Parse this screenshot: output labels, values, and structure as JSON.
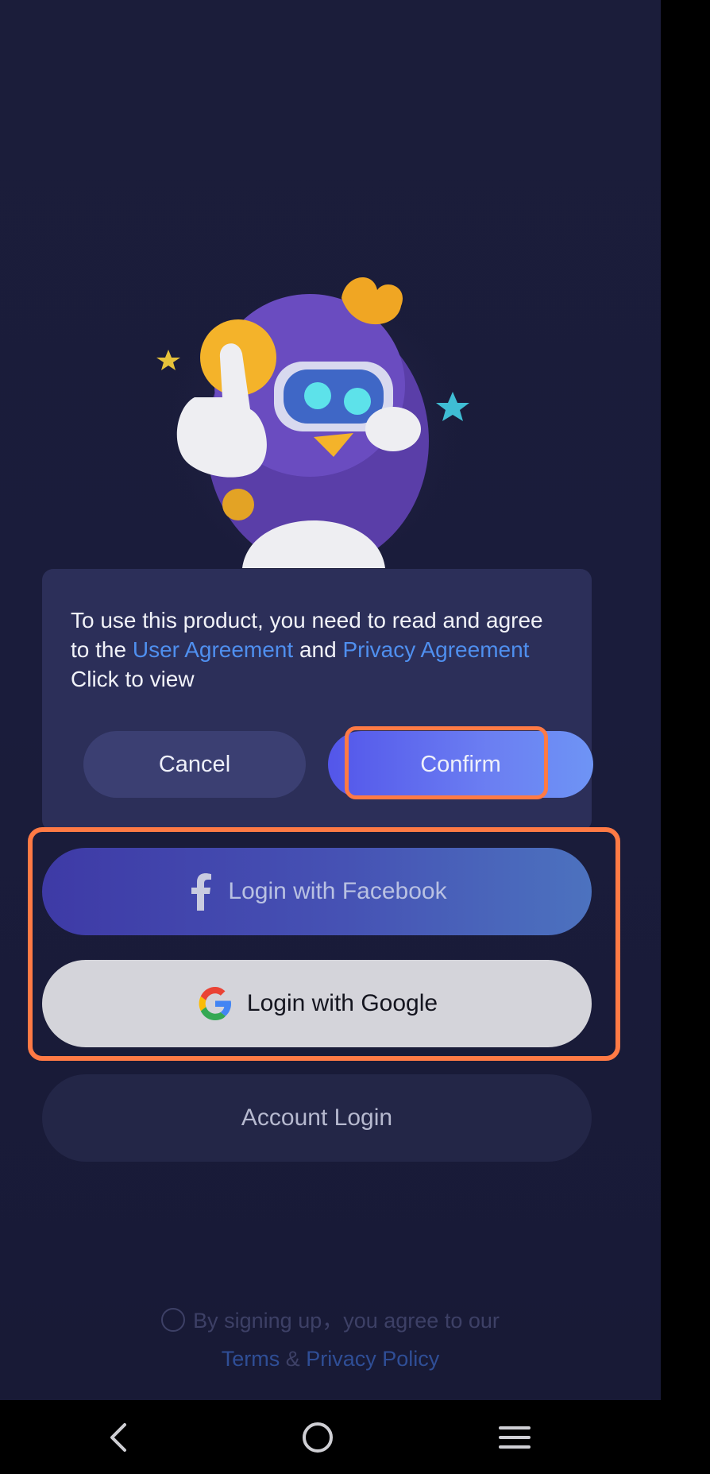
{
  "dialog": {
    "text_prefix": "To use this product, you need to read and agree to the",
    "user_agreement": "User Agreement",
    "and": "and",
    "privacy_agreement": "Privacy Agreement",
    "text_suffix": "Click to view",
    "cancel_label": "Cancel",
    "confirm_label": "Confirm"
  },
  "login": {
    "facebook_label": "Login with Facebook",
    "google_label": "Login with Google",
    "account_label": "Account Login"
  },
  "terms": {
    "text": "By signing up，you agree to our",
    "terms_link": "Terms",
    "amp": "&",
    "privacy_link": "Privacy Policy"
  },
  "navbar": {
    "back": "back-icon",
    "home": "home-icon",
    "menu": "menu-icon"
  },
  "colors": {
    "accent": "#5356ea",
    "link": "#4f8fef",
    "highlight": "#ff7a45",
    "background": "#1b1d3a"
  }
}
